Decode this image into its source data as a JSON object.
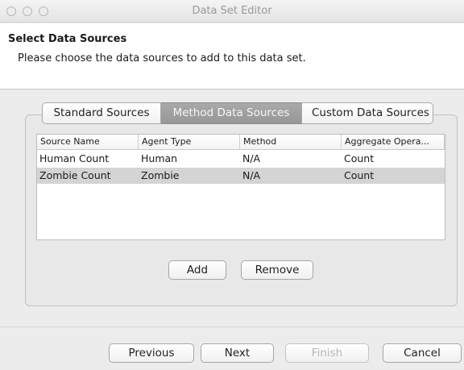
{
  "window": {
    "title": "Data Set Editor"
  },
  "header": {
    "title": "Select Data Sources",
    "subtitle": "Please choose the data sources to add to this data set."
  },
  "tabs": [
    {
      "label": "Standard Sources",
      "selected": false
    },
    {
      "label": "Method Data Sources",
      "selected": true
    },
    {
      "label": "Custom Data Sources",
      "selected": false
    }
  ],
  "table": {
    "columns": [
      "Source Name",
      "Agent Type",
      "Method",
      "Aggregate Opera..."
    ],
    "rows": [
      {
        "source_name": "Human Count",
        "agent_type": "Human",
        "method": "N/A",
        "aggregate": "Count",
        "selected": false
      },
      {
        "source_name": "Zombie Count",
        "agent_type": "Zombie",
        "method": "N/A",
        "aggregate": "Count",
        "selected": true
      }
    ]
  },
  "actions": {
    "add_label": "Add",
    "remove_label": "Remove"
  },
  "nav": {
    "previous_label": "Previous",
    "next_label": "Next",
    "finish_label": "Finish",
    "finish_enabled": false,
    "cancel_label": "Cancel"
  }
}
